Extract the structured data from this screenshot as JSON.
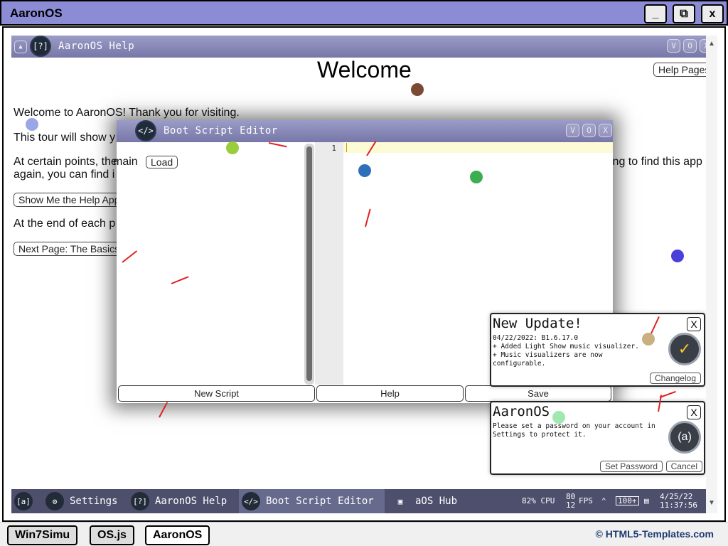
{
  "outer": {
    "title": "AaronOS",
    "minimize": "_",
    "restore": "⧉",
    "close": "x"
  },
  "bottom": {
    "links": [
      "Win7Simu",
      "OS.js",
      "AaronOS"
    ],
    "credit": "© HTML5-Templates.com"
  },
  "help_window": {
    "title": "AaronOS Help",
    "icon_text": "[?]",
    "heading": "Welcome",
    "help_pages_button": "Help Pages",
    "p1": "Welcome to AaronOS! Thank you for visiting.",
    "p2": "This tour will show y",
    "p3a": "At certain points, the",
    "p3b_tail": "ing to find this app",
    "p4": "again, you can find i",
    "show_me_button": "Show Me the Help App",
    "p5": "At the end of each p",
    "next_page_button": "Next Page: The Basics",
    "controls": [
      "V",
      "O",
      "X"
    ]
  },
  "editor": {
    "title": "Boot Script Editor",
    "icon_text": "</>",
    "main_label": "main",
    "load_button": "Load",
    "line_number": "1",
    "buttons": [
      "New Script",
      "Help",
      "Save"
    ],
    "controls": [
      "V",
      "O",
      "X"
    ]
  },
  "update_notice": {
    "title": "New Update!",
    "body": "04/22/2022: B1.6.17.0\n+ Added Light Show music visualizer.\n+ Music visualizers are now\nconfigurable.",
    "button": "Changelog",
    "close": "X"
  },
  "password_notice": {
    "title": "AaronOS",
    "body": "Please set a password on your account in\nSettings to protect it.",
    "set_password_button": "Set Password",
    "cancel_button": "Cancel",
    "close": "X"
  },
  "taskbar": {
    "start_icon": "[a]",
    "items": [
      {
        "label": "Settings",
        "icon": "gear-icon"
      },
      {
        "label": "AaronOS Help",
        "icon": "help-icon"
      },
      {
        "label": "Boot Script Editor",
        "icon": "code-icon"
      },
      {
        "label": "aOS Hub",
        "icon": "hub-icon"
      }
    ],
    "cpu": "82% CPU",
    "fps_top": "80",
    "fps_bottom": "12",
    "fps_label": "FPS",
    "battery": "100+",
    "date": "4/25/22",
    "time": "11:37:56"
  },
  "colors": {
    "title_bar": "#8b8bd6",
    "window_bar": "#7777a8",
    "taskbar": "#4d4f6d"
  }
}
